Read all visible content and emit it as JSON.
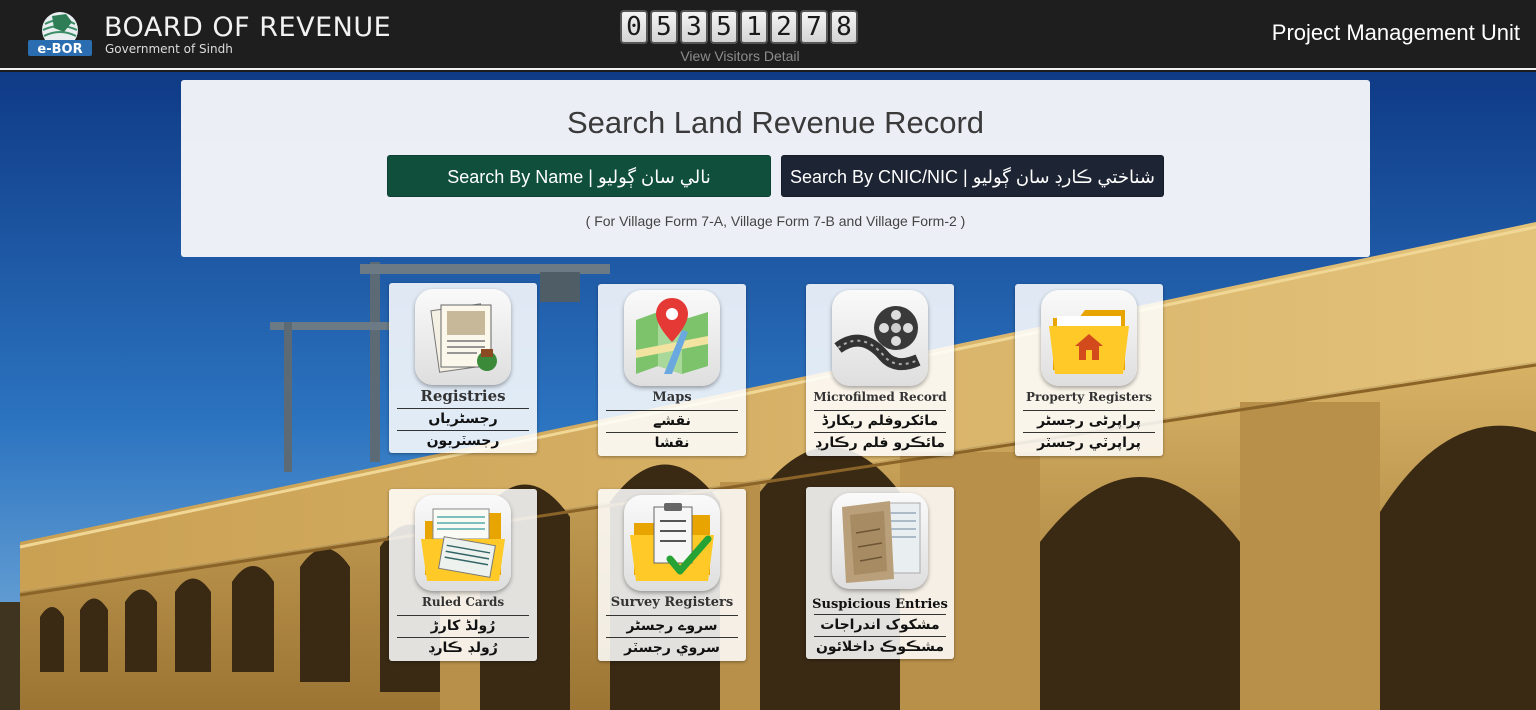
{
  "header": {
    "brand_title": "BOARD OF REVENUE",
    "brand_subtitle": "Government of Sindh",
    "logo_text": "e-BOR",
    "visitor_counter": [
      "0",
      "5",
      "3",
      "5",
      "1",
      "2",
      "7",
      "8"
    ],
    "visitors_link": "View Visitors Detail",
    "unit_name": "Project Management Unit"
  },
  "search": {
    "title": "Search Land Revenue Record",
    "by_name_button": "Search By Name | نالي سان ڳوليو",
    "by_cnic_button": "Search By CNIC/NIC | شناختي ڪارڊ سان ڳوليو",
    "note": "( For Village Form 7-A, Village Form 7-B and Village Form-2 )"
  },
  "tiles": [
    {
      "en": "Registries",
      "ur1": "رجسٹریاں",
      "ur2": "رجسٽريون",
      "icon": "registries-icon"
    },
    {
      "en": "Maps",
      "ur1": "نقشے",
      "ur2": "نقشا",
      "icon": "map-pin-icon"
    },
    {
      "en": "Microfilmed Record",
      "ur1": "مائکروفلم ریکارڈ",
      "ur2": "مائڪرو فلم رڪارڊ",
      "icon": "film-reel-icon"
    },
    {
      "en": "Property Registers",
      "ur1": "پراپرٹی رجسٹر",
      "ur2": "پراپرٽي رجسٽر",
      "icon": "home-folder-icon"
    },
    {
      "en": "Ruled Cards",
      "ur1": "رُولڈ کارڑ",
      "ur2": "رُولڊ ڪارڊ",
      "icon": "ruled-cards-icon"
    },
    {
      "en": "Survey Registers",
      "ur1": "سروے رجسٹر",
      "ur2": "سروي رجسٽر",
      "icon": "checklist-folder-icon"
    },
    {
      "en": "Suspicious Entries",
      "ur1": "مشکوک اندراجات",
      "ur2": "مشڪوڪ داخلائون",
      "icon": "old-documents-icon"
    }
  ]
}
